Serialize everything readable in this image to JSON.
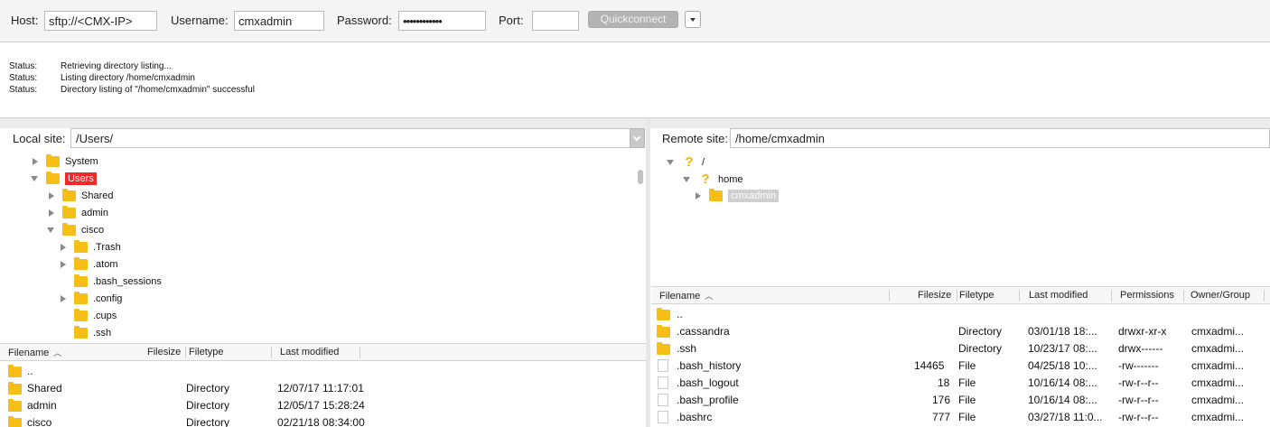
{
  "quickconnect": {
    "host_label": "Host:",
    "host_value": "sftp://<CMX-IP>",
    "username_label": "Username:",
    "username_value": "cmxadmin",
    "password_label": "Password:",
    "password_value": "••••••••••••",
    "port_label": "Port:",
    "port_value": "",
    "button_label": "Quickconnect"
  },
  "message_log": [
    {
      "key": "Status:",
      "text": "Retrieving directory listing..."
    },
    {
      "key": "Status:",
      "text": "Listing directory /home/cmxadmin"
    },
    {
      "key": "Status:",
      "text": "Directory listing of \"/home/cmxadmin\" successful"
    }
  ],
  "local": {
    "site_label": "Local site:",
    "site_value": "/Users/",
    "tree": [
      {
        "name": "System",
        "state": "closed",
        "indent": 0
      },
      {
        "name": "Users",
        "state": "open",
        "indent": 0,
        "selected": true
      },
      {
        "name": "Shared",
        "state": "closed",
        "indent": 1
      },
      {
        "name": "admin",
        "state": "closed",
        "indent": 1
      },
      {
        "name": "cisco",
        "state": "open",
        "indent": 1
      },
      {
        "name": ".Trash",
        "state": "closed",
        "indent": 2
      },
      {
        "name": ".atom",
        "state": "closed",
        "indent": 2
      },
      {
        "name": ".bash_sessions",
        "state": "none",
        "indent": 2
      },
      {
        "name": ".config",
        "state": "closed",
        "indent": 2
      },
      {
        "name": ".cups",
        "state": "none",
        "indent": 2
      },
      {
        "name": ".ssh",
        "state": "none",
        "indent": 2
      }
    ],
    "columns": [
      "Filename",
      "Filesize",
      "Filetype",
      "Last modified"
    ],
    "files": [
      {
        "name": "..",
        "size": "",
        "type": "",
        "modified": ""
      },
      {
        "name": "Shared",
        "size": "",
        "type": "Directory",
        "modified": "12/07/17 11:17:01"
      },
      {
        "name": "admin",
        "size": "",
        "type": "Directory",
        "modified": "12/05/17 15:28:24"
      },
      {
        "name": "cisco",
        "size": "",
        "type": "Directory",
        "modified": "02/21/18 08:34:00"
      }
    ]
  },
  "remote": {
    "site_label": "Remote site:",
    "site_value": "/home/cmxadmin",
    "tree": [
      {
        "name": "/",
        "indent": 0,
        "state": "open",
        "icon": "question"
      },
      {
        "name": "home",
        "indent": 1,
        "state": "open",
        "icon": "question"
      },
      {
        "name": "cmxadmin",
        "indent": 2,
        "state": "closed",
        "icon": "folder",
        "selected": true
      }
    ],
    "columns": [
      "Filename",
      "Filesize",
      "Filetype",
      "Last modified",
      "Permissions",
      "Owner/Group"
    ],
    "files": [
      {
        "name": "..",
        "size": "",
        "type": "",
        "modified": "",
        "perms": "",
        "owner": "",
        "icon": "folder"
      },
      {
        "name": ".cassandra",
        "size": "",
        "type": "Directory",
        "modified": "03/01/18 18:...",
        "perms": "drwxr-xr-x",
        "owner": "cmxadmi...",
        "icon": "folder"
      },
      {
        "name": ".ssh",
        "size": "",
        "type": "Directory",
        "modified": "10/23/17 08:...",
        "perms": "drwx------",
        "owner": "cmxadmi...",
        "icon": "folder"
      },
      {
        "name": ".bash_history",
        "size": "14465",
        "type": "File",
        "modified": "04/25/18 10:...",
        "perms": "-rw-------",
        "owner": "cmxadmi...",
        "icon": "doc"
      },
      {
        "name": ".bash_logout",
        "size": "18",
        "type": "File",
        "modified": "10/16/14 08:...",
        "perms": "-rw-r--r--",
        "owner": "cmxadmi...",
        "icon": "doc"
      },
      {
        "name": ".bash_profile",
        "size": "176",
        "type": "File",
        "modified": "10/16/14 08:...",
        "perms": "-rw-r--r--",
        "owner": "cmxadmi...",
        "icon": "doc"
      },
      {
        "name": ".bashrc",
        "size": "777",
        "type": "File",
        "modified": "03/27/18 11:0...",
        "perms": "-rw-r--r--",
        "owner": "cmxadmi...",
        "icon": "doc"
      }
    ]
  },
  "colors": {
    "folder": "#f6bf17",
    "selection_red": "#ee2a2a",
    "selection_grey": "#cfcfcf",
    "question_mark": "#f4b400"
  }
}
